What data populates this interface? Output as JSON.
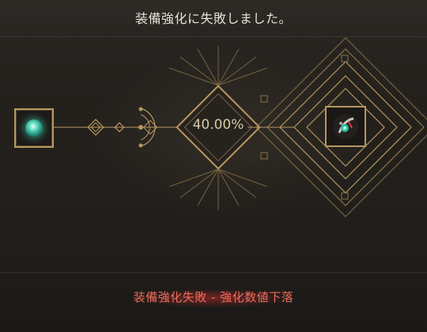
{
  "header": {
    "title": "装備強化に失敗しました。"
  },
  "enhance": {
    "success_rate": "40.00%"
  },
  "slots": {
    "source_icon": "teal-orb-icon",
    "target_icon": "equipment-item-icon"
  },
  "result": {
    "message": "装備強化失敗 - 強化数値下落"
  },
  "colors": {
    "gold": "#b8975f",
    "result_red": "#f06a5c",
    "background": "#1e1c1a"
  }
}
